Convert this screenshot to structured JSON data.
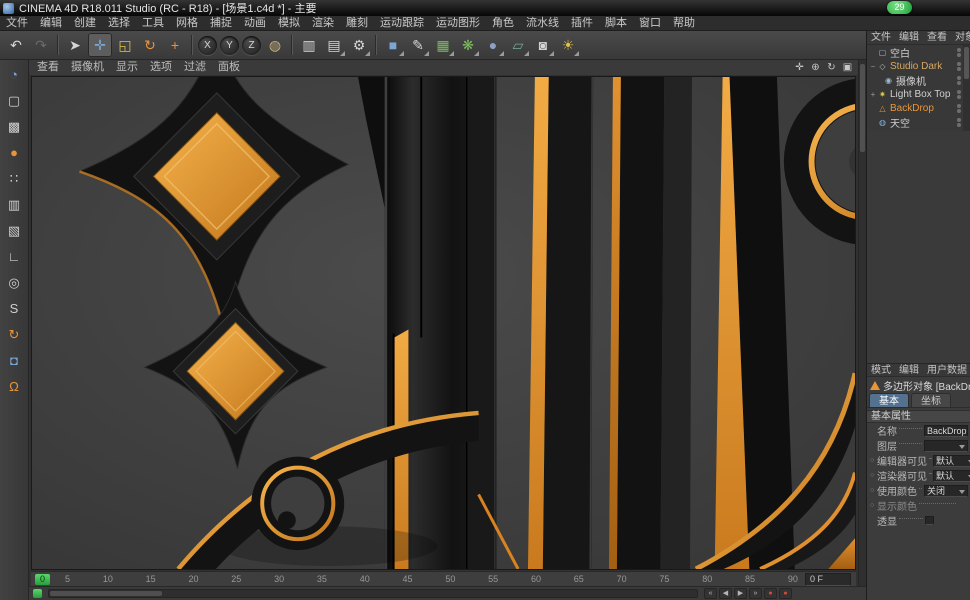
{
  "colors": {
    "accent_orange": "#e8953a",
    "selected_object_text": "#e8a13c",
    "warm_selected_text": "#d8a860",
    "active_tab_blue": "#54718f",
    "playhead_green": "#3dbb4e",
    "overlay_badge_green": "#2db84d",
    "viewport_background": "#3f3f3f",
    "render_black": "#141414"
  },
  "title_bar": {
    "title": "CINEMA 4D R18.011 Studio (RC - R18) - [场景1.c4d *] - 主要",
    "overlay_badge": "29"
  },
  "menu_bar": {
    "items": [
      "文件",
      "编辑",
      "创建",
      "选择",
      "工具",
      "网格",
      "捕捉",
      "动画",
      "模拟",
      "渲染",
      "雕刻",
      "运动跟踪",
      "运动图形",
      "角色",
      "流水线",
      "插件",
      "脚本",
      "窗口",
      "帮助"
    ]
  },
  "toolbar": {
    "icons": [
      {
        "name": "undo-icon",
        "glyph": "↶"
      },
      {
        "name": "redo-icon",
        "glyph": "↷"
      },
      {
        "name": "live-selection-icon",
        "glyph": "➤"
      },
      {
        "name": "move-tool-icon",
        "glyph": "✛"
      },
      {
        "name": "scale-tool-icon",
        "glyph": "◱"
      },
      {
        "name": "rotate-tool-icon",
        "glyph": "↻"
      },
      {
        "name": "last-tool-icon",
        "glyph": "+"
      },
      {
        "name": "lock-x-axis-icon",
        "glyph": "X"
      },
      {
        "name": "lock-y-axis-icon",
        "glyph": "Y"
      },
      {
        "name": "lock-z-axis-icon",
        "glyph": "Z"
      },
      {
        "name": "coordinate-system-icon",
        "glyph": "◍"
      },
      {
        "name": "render-view-icon",
        "glyph": "▥"
      },
      {
        "name": "render-picture-viewer-icon",
        "glyph": "▤"
      },
      {
        "name": "render-settings-icon",
        "glyph": "⚙"
      },
      {
        "name": "add-primitive-cube-icon",
        "glyph": "■"
      },
      {
        "name": "spline-pen-icon",
        "glyph": "✎"
      },
      {
        "name": "subdivision-surface-icon",
        "glyph": "▦"
      },
      {
        "name": "mograph-icon",
        "glyph": "❋"
      },
      {
        "name": "deformer-icon",
        "glyph": "●"
      },
      {
        "name": "environment-icon",
        "glyph": "▱"
      },
      {
        "name": "camera-tool-icon",
        "glyph": "◙"
      },
      {
        "name": "light-tool-icon",
        "glyph": "☀"
      }
    ]
  },
  "left_toolbar": {
    "icons": [
      {
        "name": "make-editable-icon",
        "glyph": "◔"
      },
      {
        "name": "model-mode-icon",
        "glyph": "▢"
      },
      {
        "name": "texture-mode-icon",
        "glyph": "▩"
      },
      {
        "name": "workplane-mode-icon",
        "glyph": "●"
      },
      {
        "name": "points-mode-icon",
        "glyph": "∷"
      },
      {
        "name": "edges-mode-icon",
        "glyph": "▥"
      },
      {
        "name": "polygons-mode-icon",
        "glyph": "▧"
      },
      {
        "name": "enable-axis-icon",
        "glyph": "∟"
      },
      {
        "name": "viewport-solo-icon",
        "glyph": "◎"
      },
      {
        "name": "snap-icon",
        "glyph": "S"
      },
      {
        "name": "rotate-workplane-icon",
        "glyph": "↻"
      },
      {
        "name": "lock-workplane-icon",
        "glyph": "◘"
      },
      {
        "name": "magnet-icon",
        "glyph": "Ω"
      }
    ]
  },
  "viewport": {
    "menu_items": [
      "查看",
      "摄像机",
      "显示",
      "选项",
      "过滤",
      "面板"
    ],
    "nav_icons": [
      {
        "name": "pan-view-icon",
        "glyph": "✛"
      },
      {
        "name": "zoom-view-icon",
        "glyph": "⊕"
      },
      {
        "name": "orbit-view-icon",
        "glyph": "↻"
      },
      {
        "name": "toggle-view-icon",
        "glyph": "▣"
      }
    ]
  },
  "object_manager": {
    "menu_items": [
      "文件",
      "编辑",
      "查看",
      "对象"
    ],
    "items": [
      {
        "label": "空白",
        "icon_glyph": "▢",
        "expander": ""
      },
      {
        "label": "Studio Dark",
        "icon_glyph": "◇",
        "expander": "−"
      },
      {
        "label": "摄像机",
        "icon_glyph": "◉",
        "expander": ""
      },
      {
        "label": "Light Box Top",
        "icon_glyph": "✷",
        "expander": "+"
      },
      {
        "label": "BackDrop",
        "icon_glyph": "△",
        "expander": ""
      },
      {
        "label": "天空",
        "icon_glyph": "◍",
        "expander": ""
      }
    ]
  },
  "attribute_manager": {
    "menu_items": [
      "模式",
      "编辑",
      "用户数据"
    ],
    "object_title": "多边形对象 [BackDrop]",
    "tabs": [
      "基本",
      "坐标"
    ],
    "section_title": "基本属性",
    "rows": [
      {
        "dot": "",
        "label": "名称",
        "value": "BackDrop"
      },
      {
        "dot": "",
        "label": "图层",
        "value": ""
      },
      {
        "dot": "○",
        "label": "编辑器可见",
        "value": "默认"
      },
      {
        "dot": "○",
        "label": "渲染器可见",
        "value": "默认"
      },
      {
        "dot": "○",
        "label": "使用颜色",
        "value": "关闭"
      },
      {
        "dot": "○",
        "label": "显示颜色",
        "value": ""
      },
      {
        "dot": "",
        "label": "透显",
        "value": ""
      }
    ]
  },
  "timeline": {
    "playhead_label": "0",
    "ticks": [
      "5",
      "10",
      "15",
      "20",
      "25",
      "30",
      "35",
      "40",
      "45",
      "50",
      "55",
      "60",
      "65",
      "70",
      "75",
      "80",
      "85",
      "90"
    ],
    "frame_field": "0 F"
  },
  "bottom_bar": {
    "icons": [
      {
        "name": "goto-start-icon",
        "glyph": "«"
      },
      {
        "name": "play-reverse-icon",
        "glyph": "◀"
      },
      {
        "name": "play-icon",
        "glyph": "▶"
      },
      {
        "name": "goto-end-icon",
        "glyph": "»"
      },
      {
        "name": "record-icon",
        "glyph": "●"
      },
      {
        "name": "autokey-icon",
        "glyph": "●"
      }
    ]
  }
}
